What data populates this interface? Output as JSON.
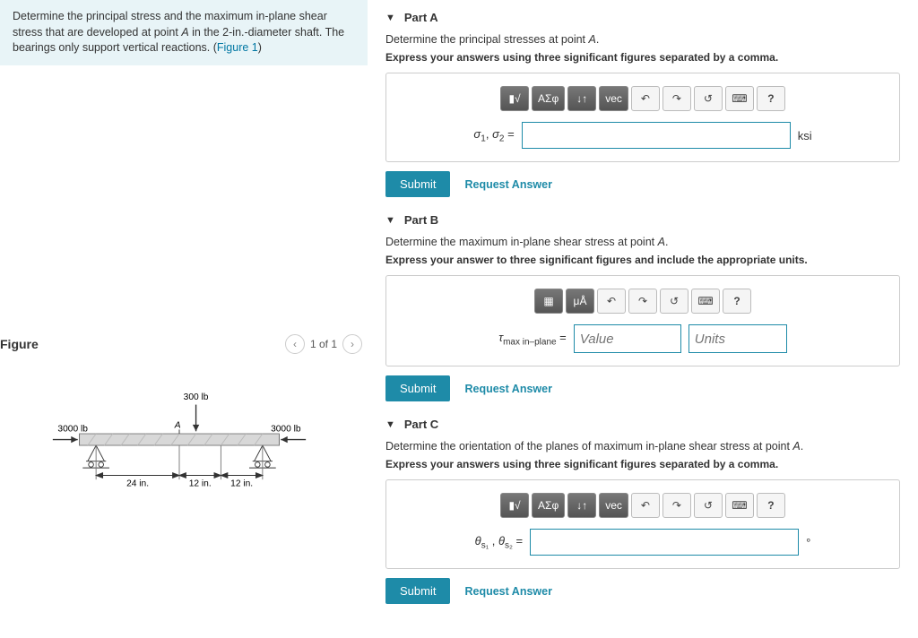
{
  "problem": {
    "text_before": "Determine the principal stress and the maximum in-plane shear stress that are developed at point ",
    "point": "A",
    "text_mid": " in the 2-in.-diameter shaft. The bearings only support vertical reactions. (",
    "figlink": "Figure 1",
    "text_after": ")"
  },
  "figure": {
    "heading": "Figure",
    "pager": "1 of 1",
    "load_top": "300 lb",
    "load_left": "3000 lb",
    "load_right": "3000 lb",
    "point_label": "A",
    "dim1": "24 in.",
    "dim2": "12 in.",
    "dim3": "12 in."
  },
  "toolbar": {
    "sqrt": "√",
    "greek": "ΑΣφ",
    "updown": "↓↑",
    "vec": "vec",
    "undo": "↶",
    "redo": "↷",
    "reset": "↺",
    "keyboard": "⌨",
    "help": "?"
  },
  "toolbarB": {
    "templates": "▦",
    "micro": "μÅ",
    "undo": "↶",
    "redo": "↷",
    "reset": "↺",
    "keyboard": "⌨",
    "help": "?"
  },
  "partA": {
    "label": "Part A",
    "prompt": "Determine the principal stresses at point A.",
    "instr": "Express your answers using three significant figures separated by a comma.",
    "lhs": "σ₁, σ₂ =",
    "unit": "ksi",
    "submit": "Submit",
    "request": "Request Answer"
  },
  "partB": {
    "label": "Part B",
    "prompt": "Determine the maximum in-plane shear stress at point A.",
    "instr": "Express your answer to three significant figures and include the appropriate units.",
    "lhs": "τmax in–plane =",
    "value_ph": "Value",
    "units_ph": "Units",
    "submit": "Submit",
    "request": "Request Answer"
  },
  "partC": {
    "label": "Part C",
    "prompt": "Determine the orientation of the planes of maximum in-plane shear stress at point A.",
    "instr": "Express your answers using three significant figures separated by a comma.",
    "lhs": "θs₁ , θs₂ =",
    "unit": "°",
    "submit": "Submit",
    "request": "Request Answer"
  }
}
